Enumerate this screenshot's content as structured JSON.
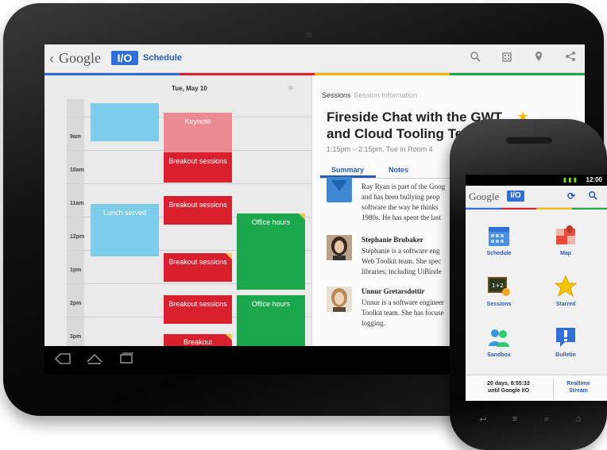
{
  "colors": {
    "google_blue": "#2f6fd6",
    "brand_blue": "#2a5db0",
    "google_red": "#d8202e",
    "google_green": "#1aa84b",
    "google_yellow": "#f5b800",
    "block_blue": "#7ccde9",
    "block_pink": "#ec8a93"
  },
  "tablet": {
    "actionbar": {
      "back_icon": "chevron-left-icon",
      "logo_text": "Google",
      "logo_badge": "I/O",
      "title": "Schedule",
      "icons": [
        "search-icon",
        "building-icon",
        "map-pin-icon",
        "share-icon"
      ]
    },
    "schedule": {
      "date": "Tue, May 10",
      "next_icon": "chevrons-right-icon",
      "times": [
        "9am",
        "10am",
        "11am",
        "12pm",
        "1pm",
        "2pm",
        "3pm"
      ],
      "blocks": {
        "keynote": "Keynote",
        "breakout_1": "Breakout sessions",
        "breakout_2": "Breakout sessions",
        "breakout_3": "Breakout sessions",
        "breakout_4": "Breakout sessions",
        "breakout_5": "Breakout",
        "lunch": "Lunch served",
        "office_1": "Office hours",
        "office_2": "Office hours"
      }
    },
    "session": {
      "crumb": "Sessions",
      "crumb_secondary": "Session Information",
      "title": "Fireside Chat with the GWT and Cloud Tooling Team",
      "time": "1:15pm – 2:15pm, Tue in Room 4",
      "starred": true,
      "tabs": [
        "Summary",
        "Notes"
      ],
      "speakers": [
        {
          "name": "",
          "lines": [
            "Ray Ryan is part of the Goog",
            "and has been bullying peop",
            "software the way he thinks",
            "1980s. He has spent the last"
          ]
        },
        {
          "name": "Stephanie Brubaker",
          "lines": [
            "Stephanie is a software eng",
            "Web Toolkit team. She spec",
            "libraries, including UiBinde"
          ]
        },
        {
          "name": "Unnur Gretarsdottir",
          "lines": [
            "Unnur is a software engineer",
            "Toolkit team. She has focuse",
            "logging."
          ]
        }
      ]
    },
    "navbar": {
      "back": "back-icon",
      "home": "home-icon",
      "recents": "recents-icon"
    }
  },
  "phone": {
    "status": {
      "time": "12:00"
    },
    "actionbar": {
      "logo_text": "Google",
      "logo_badge": "I/O",
      "icons": [
        "refresh-icon",
        "search-icon"
      ]
    },
    "dashboard": [
      {
        "label": "Schedule",
        "icon": "calendar-icon"
      },
      {
        "label": "Map",
        "icon": "map-icon"
      },
      {
        "label": "Sessions",
        "icon": "chalkboard-icon"
      },
      {
        "label": "Starred",
        "icon": "star-icon"
      },
      {
        "label": "Sandbox",
        "icon": "people-icon"
      },
      {
        "label": "Bulletin",
        "icon": "exclamation-icon"
      }
    ],
    "footer": {
      "countdown_line1": "20 days, 8:55:32",
      "countdown_line2": "until Google I/O",
      "realtime_line1": "Realtime",
      "realtime_line2": "Stream"
    }
  }
}
